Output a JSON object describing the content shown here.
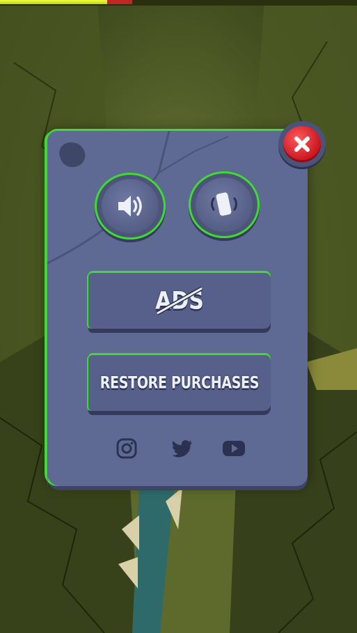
{
  "hud": {
    "health_fraction": 0.3,
    "damage_fraction": 0.07,
    "colors": {
      "health": "#e4f02c",
      "damage": "#c42424"
    }
  },
  "settings_panel": {
    "close_icon": "close-x-icon",
    "sound_toggle": {
      "icon": "speaker-icon",
      "state": "on"
    },
    "vibration_toggle": {
      "icon": "vibration-phone-icon",
      "state": "on"
    },
    "remove_ads_button": {
      "label": "ADS",
      "icon": "strikethrough-icon"
    },
    "restore_button": {
      "label": "RESTORE PURCHASES"
    },
    "social_links": [
      {
        "icon": "instagram-icon"
      },
      {
        "icon": "twitter-icon"
      },
      {
        "icon": "youtube-icon"
      }
    ],
    "colors": {
      "panel": "#5e6a94",
      "border_glow": "#3ddc2f",
      "close": "#d8202a"
    }
  }
}
